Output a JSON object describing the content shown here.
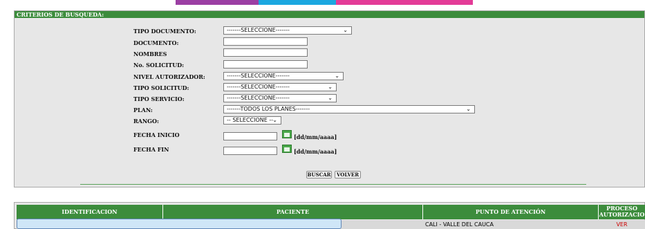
{
  "form": {
    "header": "CRITERIOS DE BUSQUEDA:",
    "fields": {
      "tipo_documento": {
        "label": "TIPO DOCUMENTO:",
        "value": "-------SELECCIONE-------"
      },
      "documento": {
        "label": "DOCUMENTO:",
        "value": ""
      },
      "nombres": {
        "label": "NOMBRES",
        "value": ""
      },
      "no_solicitud": {
        "label": "No. SOLICITUD:",
        "value": ""
      },
      "nivel_autorizador": {
        "label": "NIVEL AUTORIZADOR:",
        "value": "-------SELECCIONE-------"
      },
      "tipo_solicitud": {
        "label": "TIPO SOLICITUD:",
        "value": "-------SELECCIONE-------"
      },
      "tipo_servicio": {
        "label": "TIPO SERVICIO:",
        "value": "-------SELECCIONE-------"
      },
      "plan": {
        "label": "PLAN:",
        "value": "-------TODOS LOS PLANES-------"
      },
      "rango": {
        "label": "RANGO:",
        "value": "-- SELECCIONE --"
      },
      "fecha_inicio": {
        "label": "FECHA INICIO",
        "value": "",
        "format": "[dd/mm/aaaa]"
      },
      "fecha_fin": {
        "label": "FECHA FIN",
        "value": "",
        "format": "[dd/mm/aaaa]"
      }
    },
    "buttons": {
      "buscar": "BUSCAR",
      "volver": "VOLVER"
    }
  },
  "results": {
    "columns": [
      "IDENTIFICACION",
      "PACIENTE",
      "PUNTO DE ATENCIÓN",
      "PROCESO AUTORIZACIO"
    ],
    "rows": [
      {
        "punto_atencion": "CALI - VALLE DEL CAUCA",
        "action": "VER"
      }
    ]
  },
  "colors": {
    "header_green": "#3c8c3c",
    "panel_gray": "#e7e7e7",
    "link_red": "#cc0000"
  }
}
